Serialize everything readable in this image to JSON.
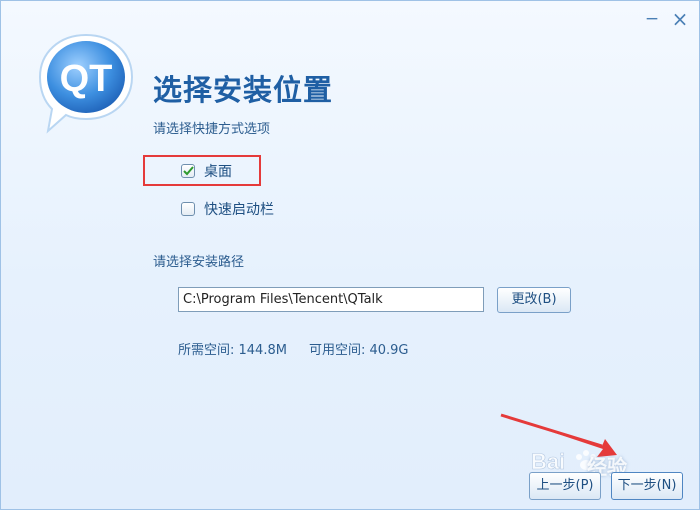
{
  "window": {
    "minimize_glyph": "−",
    "close_glyph": "×"
  },
  "logo": {
    "text": "QT"
  },
  "header": {
    "title": "选择安装位置",
    "subtitle": "请选择快捷方式选项"
  },
  "shortcuts": {
    "desktop": {
      "label": "桌面",
      "checked": true
    },
    "quick_launch": {
      "label": "快速启动栏",
      "checked": false
    }
  },
  "install_path": {
    "label": "请选择安装路径",
    "value": "C:\\Program Files\\Tencent\\QTalk",
    "change_button": "更改(B)"
  },
  "space": {
    "required": "所需空间: 144.8M",
    "available": "可用空间: 40.9G"
  },
  "watermark": {
    "text": "经验"
  },
  "footer": {
    "prev_button": "上一步(P)",
    "next_button": "下一步(N)"
  },
  "colors": {
    "accent": "#1f5fa4",
    "highlight": "#e53a3a",
    "check": "#2e9a2e"
  }
}
